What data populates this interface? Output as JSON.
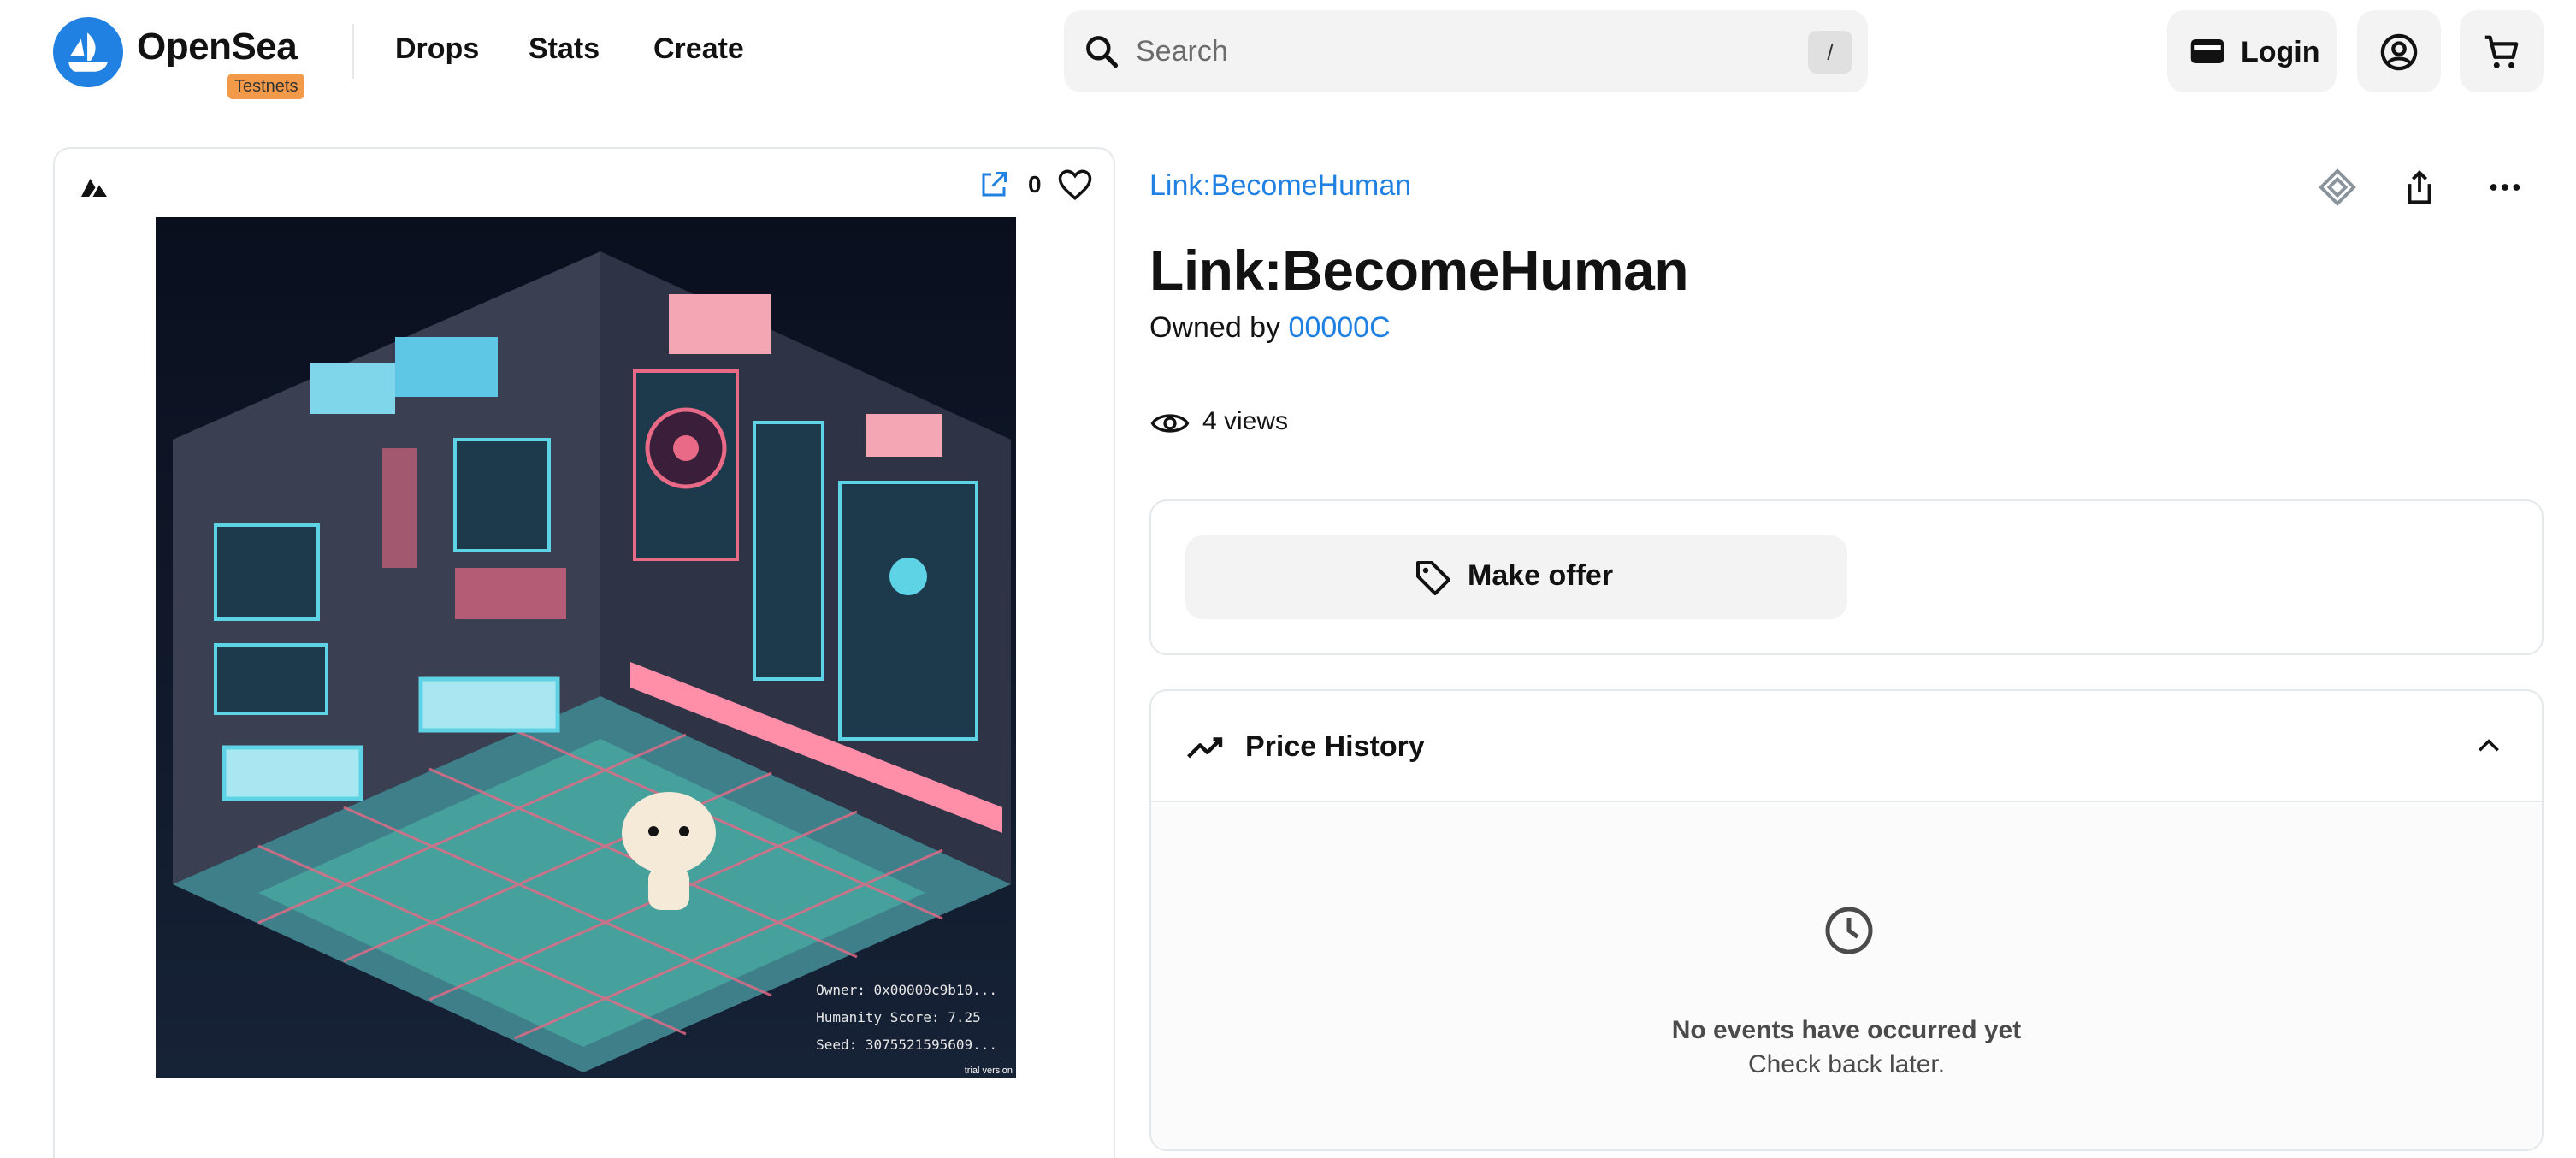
{
  "header": {
    "brand": "OpenSea",
    "badge": "Testnets",
    "nav": [
      "Drops",
      "Stats",
      "Create"
    ],
    "search_placeholder": "Search",
    "search_shortcut": "/",
    "login_label": "Login",
    "icons": [
      "opensea-logo-icon",
      "search-icon",
      "wallet-icon",
      "account-icon",
      "cart-icon"
    ],
    "colors": {
      "brand_blue": "#2081e2",
      "badge_orange": "#f2994a"
    }
  },
  "media": {
    "favorite_count": "0",
    "icons": [
      "chain-icon",
      "external-link-icon",
      "heart-icon"
    ],
    "art_caption": {
      "owner": "Owner: 0x00000c9b10...",
      "score": "Humanity Score: 7.25",
      "seed": "Seed: 3075521595609..."
    },
    "watermark": "trial version"
  },
  "detail": {
    "collection": "Link:BecomeHuman",
    "title": "Link:BecomeHuman",
    "owned_by_label": "Owned by",
    "owner": "00000C",
    "views": "4 views",
    "action_icons": [
      "offer-deal-icon",
      "share-icon",
      "more-icon"
    ]
  },
  "offer": {
    "label": "Make offer",
    "icon": "tag-icon"
  },
  "price_history": {
    "title": "Price History",
    "empty_title": "No events have occurred yet",
    "empty_subtitle": "Check back later."
  }
}
